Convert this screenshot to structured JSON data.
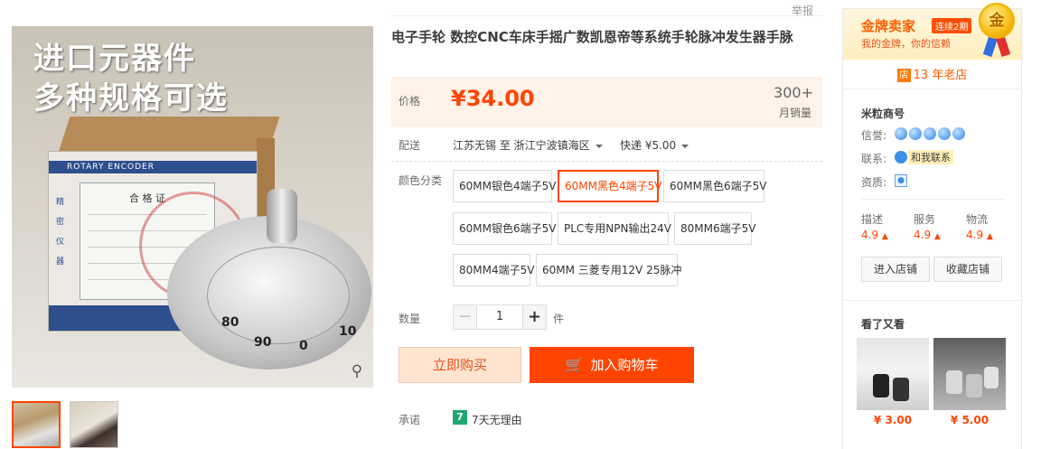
{
  "report": "举报",
  "product": {
    "title": "电子手轮 数控CNC车床手摇广数凯恩帝等系统手轮脉冲发生器手脉",
    "promo_line1": "进口元器件",
    "promo_line2": "多种规格可选",
    "box_text": "ROTARY ENCODER",
    "cert_title": "合 格 证",
    "box_vertical": "精密仪器",
    "dial_numbers": [
      "80",
      "90",
      "0",
      "10"
    ]
  },
  "price": {
    "label": "价格",
    "value": "¥34.00",
    "sold_count": "300+",
    "sold_label": "月销量"
  },
  "shipping": {
    "label": "配送",
    "from_to": "江苏无锡 至  浙江宁波镇海区",
    "method": "快递 ¥5.00"
  },
  "color": {
    "label": "颜色分类",
    "options": [
      "60MM银色4端子5V",
      "60MM黑色4端子5V",
      "60MM黑色6端子5V",
      "60MM银色6端子5V",
      "PLC专用NPN输出24V",
      "80MM6端子5V",
      "80MM4端子5V",
      "60MM 三菱专用12V 25脉冲"
    ],
    "selected": "60MM黑色4端子5V"
  },
  "quantity": {
    "label": "数量",
    "value": "1",
    "unit": "件",
    "minus": "−",
    "plus": "+"
  },
  "actions": {
    "buy_now": "立即购买",
    "add_cart": "加入购物车"
  },
  "promise": {
    "label": "承诺",
    "icon_text": "7",
    "text": "7天无理由"
  },
  "shop": {
    "gold_title": "金牌卖家",
    "gold_badge": "连续2期",
    "gold_sub": "我的金牌，你的信赖",
    "medal_text": "金",
    "years_icon": "店",
    "years": "13 年老店",
    "name": "米粒商号",
    "credit_label": "信誉:",
    "contact_label": "联系:",
    "contact_text": "和我联系",
    "qualification_label": "资质:",
    "scores": [
      {
        "label": "描述",
        "value": "4.9"
      },
      {
        "label": "服务",
        "value": "4.9"
      },
      {
        "label": "物流",
        "value": "4.9"
      }
    ],
    "enter_shop": "进入店铺",
    "fav_shop": "收藏店铺",
    "seen_title": "看了又看",
    "recommend": [
      {
        "price": "¥ 3.00"
      },
      {
        "price": "¥ 5.00"
      }
    ]
  },
  "colors": {
    "accent": "#ff4400",
    "price": "#ff4400",
    "gold": "#ff5e00"
  }
}
